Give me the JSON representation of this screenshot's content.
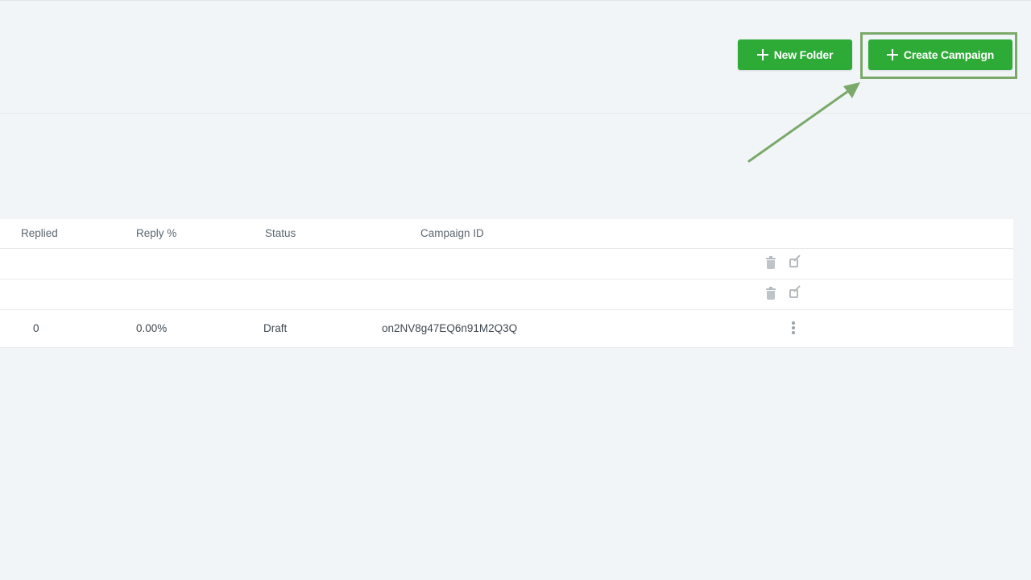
{
  "toolbar": {
    "new_folder_label": "New Folder",
    "create_campaign_label": "Create Campaign"
  },
  "table": {
    "columns": [
      "Replied",
      "Reply %",
      "Status",
      "Campaign ID"
    ],
    "rows": [
      {
        "replied": "",
        "reply_pct": "",
        "status": "",
        "campaign_id": "",
        "actions": [
          "trash-icon",
          "edit-icon"
        ]
      },
      {
        "replied": "",
        "reply_pct": "",
        "status": "",
        "campaign_id": "",
        "actions": [
          "trash-icon",
          "edit-icon"
        ]
      },
      {
        "replied": "0",
        "reply_pct": "0.00%",
        "status": "Draft",
        "campaign_id": "on2NV8g47EQ6n91M2Q3Q",
        "actions": [
          "more-vertical-icon"
        ]
      }
    ]
  },
  "colors": {
    "button_green": "#2eab37",
    "highlight": "#7aa96a",
    "background": "#f1f5f8"
  }
}
